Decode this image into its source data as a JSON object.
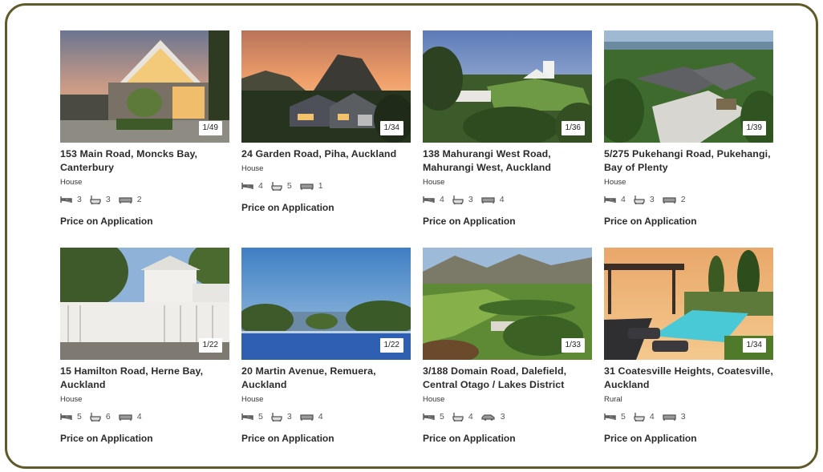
{
  "listings": [
    {
      "address": "153 Main Road, Moncks Bay, Canterbury",
      "type": "House",
      "counter": "1/49",
      "beds": "3",
      "baths": "3",
      "third_icon": "sofa-icon",
      "third": "2",
      "price": "Price on Application"
    },
    {
      "address": "24 Garden Road, Piha, Auckland",
      "type": "House",
      "counter": "1/34",
      "beds": "4",
      "baths": "5",
      "third_icon": "sofa-icon",
      "third": "1",
      "price": "Price on Application"
    },
    {
      "address": "138 Mahurangi West Road, Mahurangi West, Auckland",
      "type": "House",
      "counter": "1/36",
      "beds": "4",
      "baths": "3",
      "third_icon": "sofa-icon",
      "third": "4",
      "price": "Price on Application"
    },
    {
      "address": "5/275 Pukehangi Road, Pukehangi, Bay of Plenty",
      "type": "House",
      "counter": "1/39",
      "beds": "4",
      "baths": "3",
      "third_icon": "sofa-icon",
      "third": "2",
      "price": "Price on Application"
    },
    {
      "address": "15 Hamilton Road, Herne Bay, Auckland",
      "type": "House",
      "counter": "1/22",
      "beds": "5",
      "baths": "6",
      "third_icon": "sofa-icon",
      "third": "4",
      "price": "Price on Application"
    },
    {
      "address": "20 Martin Avenue, Remuera, Auckland",
      "type": "House",
      "counter": "1/22",
      "beds": "5",
      "baths": "3",
      "third_icon": "sofa-icon",
      "third": "4",
      "price": "Price on Application"
    },
    {
      "address": "3/188 Domain Road, Dalefield, Central Otago / Lakes District",
      "type": "House",
      "counter": "1/33",
      "beds": "5",
      "baths": "4",
      "third_icon": "car-icon",
      "third": "3",
      "price": "Price on Application"
    },
    {
      "address": "31 Coatesville Heights, Coatesville, Auckland",
      "type": "Rural",
      "counter": "1/34",
      "beds": "5",
      "baths": "4",
      "third_icon": "sofa-icon",
      "third": "3",
      "price": "Price on Application"
    }
  ],
  "colors": {
    "frame": "#5e5a2a",
    "text": "#2b2b2b",
    "icon": "#555555"
  }
}
